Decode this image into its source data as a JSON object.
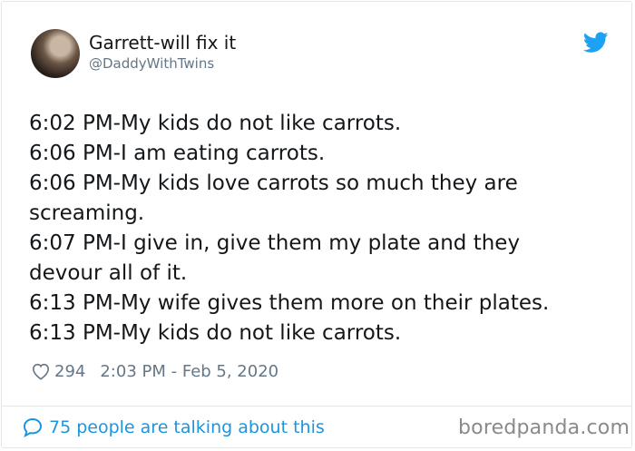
{
  "author": {
    "display_name": "Garrett-will fix it",
    "handle": "@DaddyWithTwins"
  },
  "tweet": {
    "lines": [
      "6:02 PM-My kids do not like carrots.",
      "6:06 PM-I am eating carrots.",
      "6:06 PM-My kids love carrots so much they are",
      "screaming.",
      "6:07 PM-I give in, give them my plate and they",
      "devour all of it.",
      "6:13 PM-My wife gives them more on their plates.",
      "6:13 PM-My kids do not like carrots."
    ]
  },
  "meta": {
    "like_count": "294",
    "timestamp": "2:03 PM - Feb 5, 2020"
  },
  "footer": {
    "talking_text": "75 people are talking about this",
    "watermark": "boredpanda.com"
  },
  "colors": {
    "twitter_blue": "#1da1f2",
    "link_blue": "#1b95e0",
    "secondary_text": "#657786"
  },
  "icons": {
    "brand": "twitter-bird-icon",
    "like": "heart-icon",
    "reply": "speech-bubble-icon"
  }
}
